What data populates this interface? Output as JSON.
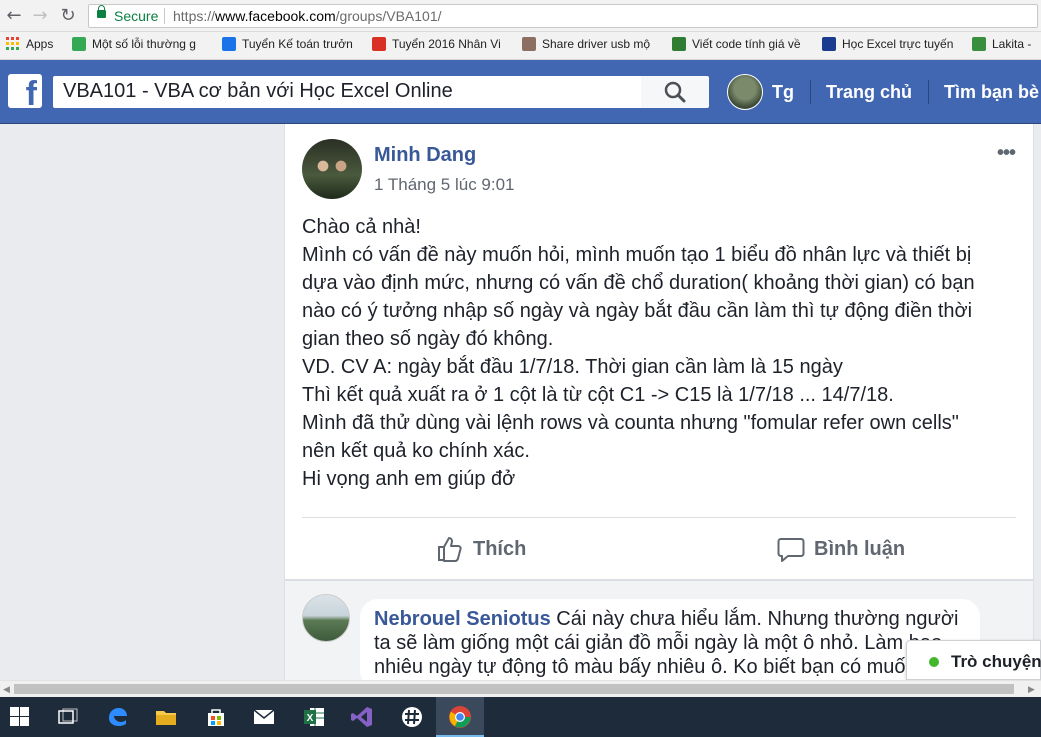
{
  "browser": {
    "back_icon": "arrow-left-icon",
    "forward_icon": "arrow-right-icon",
    "reload_icon": "reload-icon",
    "secure_label": "Secure",
    "url_scheme": "https://",
    "url_host": "www.facebook.com",
    "url_path": "/groups/VBA101/"
  },
  "bookmarks": [
    {
      "label": "Apps",
      "color": "#e94235"
    },
    {
      "label": "Một số lỗi thường g",
      "color": "#34a853"
    },
    {
      "label": "Tuyển Kế toán trưởn",
      "color": "#1a73e8"
    },
    {
      "label": "Tuyển 2016 Nhân Vi",
      "color": "#d93025"
    },
    {
      "label": "Share driver usb mộ",
      "color": "#8d6e63"
    },
    {
      "label": "Viết code tính giá về",
      "color": "#2e7d32"
    },
    {
      "label": "Học Excel trực tuyến",
      "color": "#1a3c8f"
    },
    {
      "label": "Lakita -",
      "color": "#388e3c"
    }
  ],
  "facebook": {
    "logo": "f",
    "search_value": "VBA101 - VBA cơ bản với Học Excel Online",
    "search_icon": "magnifier-icon",
    "profile_name": "Tg",
    "nav_home": "Trang chủ",
    "nav_find_friends": "Tìm bạn bè"
  },
  "post": {
    "author": "Minh Dang",
    "timestamp": "1 Tháng 5 lúc 9:01",
    "more": "•••",
    "lines": [
      "Chào cả nhà!",
      "Mình có vấn đề này muốn hỏi, mình muốn tạo 1 biểu đồ nhân lực và thiết bị",
      "dựa vào định mức, nhưng có vấn đề chổ duration( khoảng thời gian) có bạn",
      "nào có ý tưởng nhập số ngày và ngày bắt đầu cần làm thì tự động điền thời",
      "gian theo số ngày đó không.",
      "VD. CV A: ngày bắt đầu 1/7/18. Thời gian cần làm là 15 ngày",
      "Thì kết quả xuất ra ở 1 cột là từ cột C1 -> C15 là 1/7/18 ... 14/7/18.",
      "Mình đã thử dùng vài lệnh rows và counta nhưng \"fomular refer own cells\"",
      "nên kết quả ko chính xác.",
      "Hi vọng anh em giúp đở"
    ],
    "like_label": "Thích",
    "comment_label": "Bình luận"
  },
  "comment": {
    "author": "Nebrouel Seniotus",
    "line1_rest": " Cái này chưa hiểu lắm. Nhưng thường người",
    "line2": "ta sẽ làm giống một cái giản đồ mỗi ngày là một ô nhỏ. Làm bao",
    "line3": "nhiêu ngày tự động tô màu bấy nhiêu ô. Ko biết bạn có muốn"
  },
  "chat": {
    "label": "Trò chuyện",
    "status_color": "#42b72a"
  },
  "taskbar": {
    "items": [
      "windows-start-icon",
      "task-view-icon",
      "edge-icon",
      "file-explorer-icon",
      "store-icon",
      "mail-icon",
      "excel-icon",
      "visual-studio-icon",
      "slack-icon",
      "chrome-icon"
    ]
  }
}
